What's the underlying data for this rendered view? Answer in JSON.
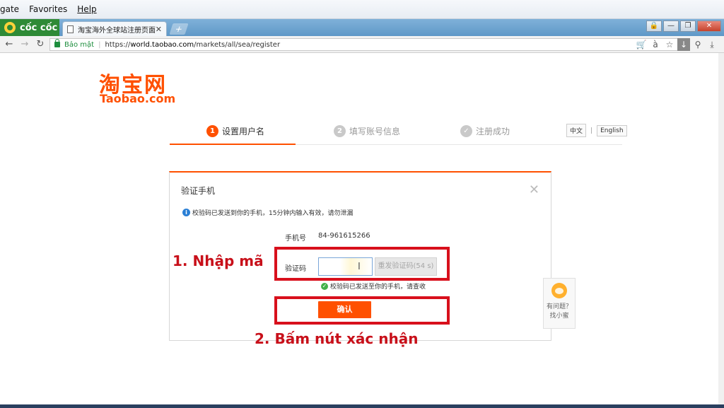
{
  "menubar": {
    "items": [
      "gate",
      "Favorites",
      "Help"
    ]
  },
  "browser": {
    "brand": "cốc cốc",
    "tab_title": "淘宝海外全球站注册页面",
    "tab_close": "✕",
    "new_tab": "+",
    "secure_label": "Bảo mật",
    "url_scheme": "https://",
    "url_domain": "world.taobao.com",
    "url_path": "/markets/all/sea/register",
    "window_controls": [
      "🔒",
      "—",
      "❐",
      "✕"
    ]
  },
  "logo": {
    "cn": "淘宝网",
    "en": "Taobao.com"
  },
  "steps": [
    {
      "num": "1",
      "label": "设置用户名",
      "state": "active"
    },
    {
      "num": "2",
      "label": "填写账号信息",
      "state": "inactive"
    },
    {
      "num": "✓",
      "label": "注册成功",
      "state": "inactive"
    }
  ],
  "language": {
    "zh": "中文",
    "divider": "|",
    "en": "English"
  },
  "dialog": {
    "title": "验证手机",
    "close": "✕",
    "info_text": "校验码已发送到你的手机，15分钟内输入有效，请勿泄漏",
    "phone_label": "手机号",
    "phone_value": "84-961615266",
    "code_label": "验证码",
    "code_value": "",
    "resend_label": "重发验证码(54 s)",
    "sent_text": "校验码已发送至你的手机，请查收",
    "confirm_label": "确认"
  },
  "annotations": {
    "step1": "1. Nhập mã",
    "step2": "2. Bấm nút xác nhận"
  },
  "help": {
    "line1": "有问题？",
    "line2": "找小蜜"
  },
  "colors": {
    "brand": "#ff5000",
    "annotation": "#d8101c"
  }
}
